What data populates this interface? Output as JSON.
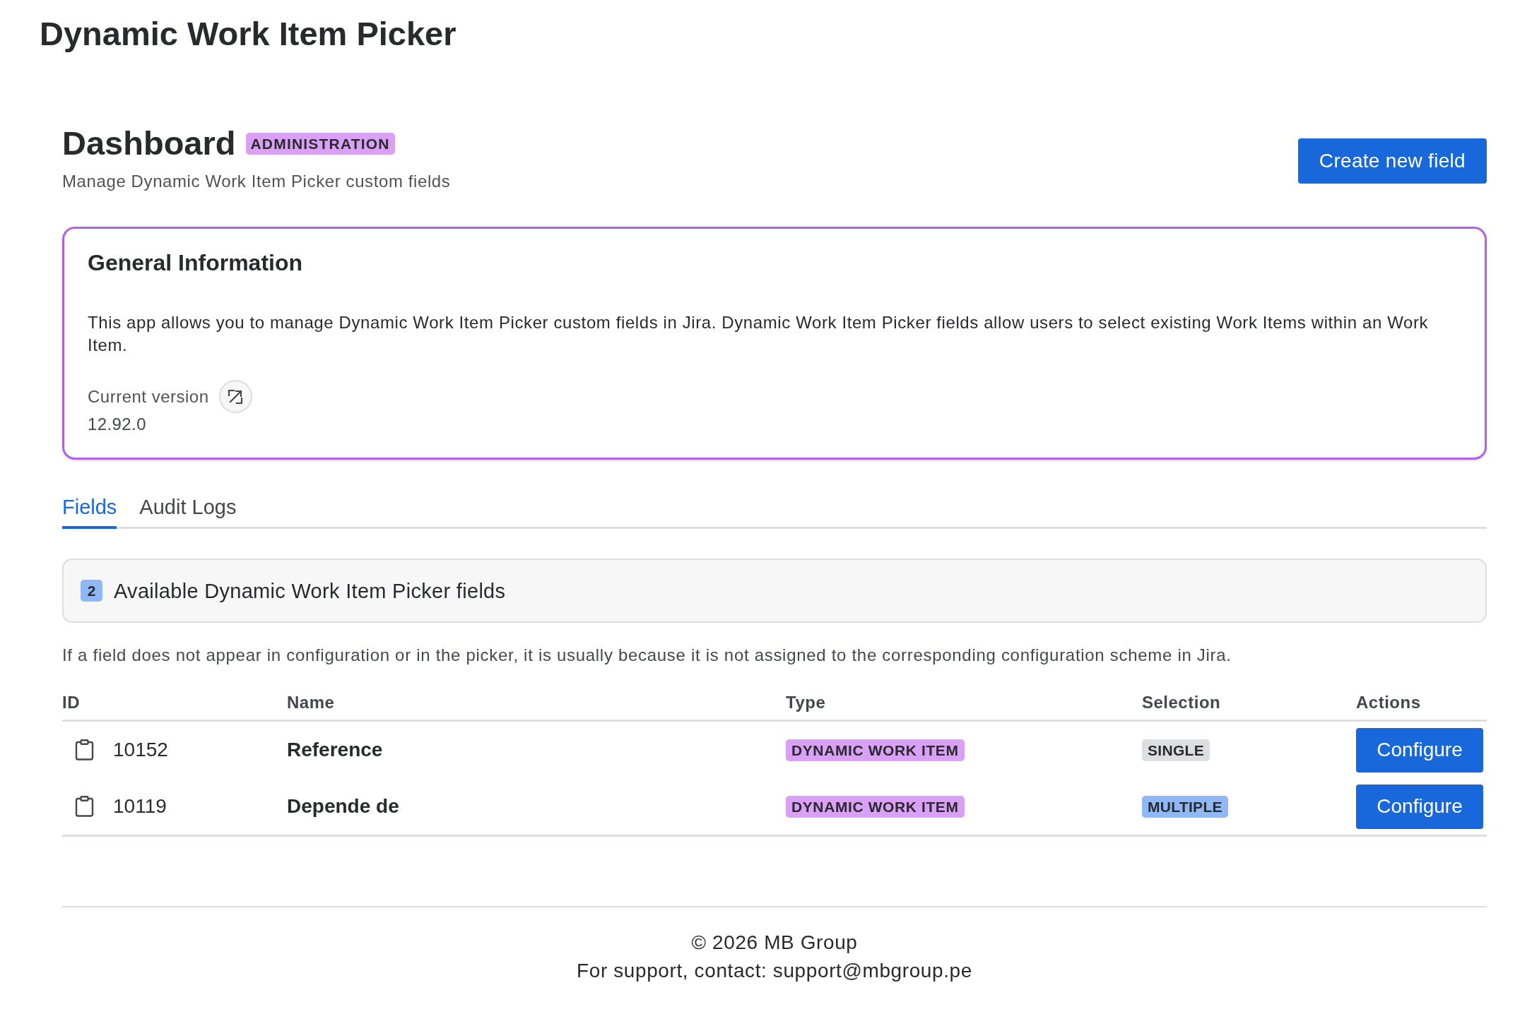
{
  "app_title": "Dynamic Work Item Picker",
  "header": {
    "title": "Dashboard",
    "badge": "ADMINISTRATION",
    "subtitle": "Manage Dynamic Work Item Picker custom fields",
    "create_button": "Create new field"
  },
  "info_card": {
    "title": "General Information",
    "description": "This app allows you to manage Dynamic Work Item Picker custom fields in Jira. Dynamic Work Item Picker fields allow users to select existing Work Items within an Work Item.",
    "version_label": "Current version",
    "version": "12.92.0"
  },
  "tabs": [
    {
      "label": "Fields",
      "selected": true
    },
    {
      "label": "Audit Logs",
      "selected": false
    }
  ],
  "fields_panel": {
    "count": "2",
    "title": "Available Dynamic Work Item Picker fields"
  },
  "note": "If a field does not appear in configuration or in the picker, it is usually because it is not assigned to the corresponding configuration scheme in Jira.",
  "table": {
    "columns": [
      "ID",
      "Name",
      "Type",
      "Selection",
      "Actions"
    ],
    "rows": [
      {
        "id": "10152",
        "name": "Reference",
        "type": "DYNAMIC WORK ITEM",
        "selection": {
          "label": "SINGLE",
          "color": "#dddee1"
        },
        "action": "Configure"
      },
      {
        "id": "10119",
        "name": "Depende de",
        "type": "DYNAMIC WORK ITEM",
        "selection": {
          "label": "MULTIPLE",
          "color": "#8fb8f6"
        },
        "action": "Configure"
      }
    ]
  },
  "footer": {
    "copyright": "© 2026 MB Group",
    "support": "For support, contact: support@mbgroup.pe"
  }
}
